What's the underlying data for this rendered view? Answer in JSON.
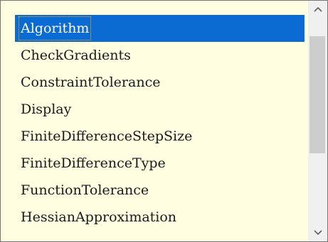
{
  "options_list": {
    "items": [
      {
        "label": "Algorithm",
        "selected": true
      },
      {
        "label": "CheckGradients",
        "selected": false
      },
      {
        "label": "ConstraintTolerance",
        "selected": false
      },
      {
        "label": "Display",
        "selected": false
      },
      {
        "label": "FiniteDifferenceStepSize",
        "selected": false
      },
      {
        "label": "FiniteDifferenceType",
        "selected": false
      },
      {
        "label": "FunctionTolerance",
        "selected": false
      },
      {
        "label": "HessianApproximation",
        "selected": false
      }
    ]
  },
  "scrollbar": {
    "up_icon": "chevron-up-icon",
    "down_icon": "chevron-down-icon",
    "scroll_position": 0.0
  },
  "colors": {
    "background": "#fffee1",
    "selection": "#0c6bd3",
    "selection_text": "#ffffff",
    "text": "#1a1a1a"
  }
}
